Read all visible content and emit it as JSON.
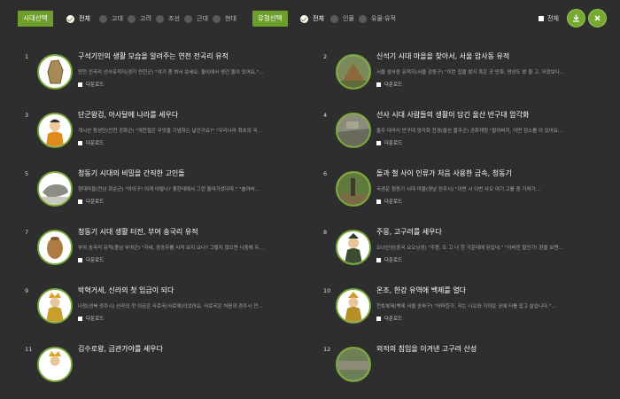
{
  "filters": {
    "era_chip": "시대선택",
    "eras": [
      {
        "label": "전체",
        "selected": true
      },
      {
        "label": "고대",
        "selected": false
      },
      {
        "label": "고려",
        "selected": false
      },
      {
        "label": "조선",
        "selected": false
      },
      {
        "label": "근대",
        "selected": false
      },
      {
        "label": "현대",
        "selected": false
      }
    ],
    "type_chip": "유형선택",
    "types": [
      {
        "label": "전체",
        "selected": true
      },
      {
        "label": "인물",
        "selected": false
      },
      {
        "label": "유물·유적",
        "selected": false
      }
    ],
    "select_all_label": "전체"
  },
  "buttons": {
    "download_icon": "download-icon",
    "close_icon": "close-icon"
  },
  "download_label": "다운로드",
  "items": [
    {
      "num": "1",
      "title": "구석기인의 생활 모습을 알려주는 연천 전곡리 유적",
      "desc": "연천 전곡리 선사유적지(경기 연천군) \"여기 좀 봐서 보세요. 돌이에서 생긴 돌이 있어요.\"…"
    },
    {
      "num": "2",
      "title": "신석기 시대 마을을 찾아서, 서울 암사동 유적",
      "desc": "서울 암사동 유적지(서울 강동구) \"이런 집을 봤지 혹은 곳 만화, 영상도 봤 줄 고, 무었보다…"
    },
    {
      "num": "3",
      "title": "단군왕검, 아사달에 나라를 세우다",
      "desc": "개시산 참성단(인천 강화군) \"개천절은 무엇을 기념하는 날인가요?\" \"우리나라 최초의 국…"
    },
    {
      "num": "4",
      "title": "선사 시대 사람들의 생활이 담긴 울산 반구대 암각화",
      "desc": "울주 대곡리 반구대 암각화 전경(울산 울주군) 공화재청 \"할아버지, 어떤 점소를 이 있어요…"
    },
    {
      "num": "5",
      "title": "청동기 시대의 비밀을 간직한 고인돌",
      "desc": "청대마을(전남 화순군) \"아이구! 이게 어떻나? 좋한데에서 그런 돌마가셨다며.\" \"솔아바…"
    },
    {
      "num": "6",
      "title": "돌과 철 사이 인류가 처음 사용한 금속, 청동기",
      "desc": "국경운 청동기 시대 마을(경남 진주시) \"이번 시 이번 사오 여기 고를 좀 가져가…"
    },
    {
      "num": "7",
      "title": "청동기 시대 생활 터전, 부여 송국리 유적",
      "desc": "부여 송국리 유적(충남 부여군) \"자네, 장승무를 서져 보지 요나? 그렇지 않으면 나중에 두…"
    },
    {
      "num": "8",
      "title": "주몽, 고구려를 세우다",
      "desc": "오녀산성(중국 요오닝성) \"주몽, 도 고 나 한 가운데에 된답네.\" \"아버린 할인가! 환을 보면…"
    },
    {
      "num": "9",
      "title": "박혁거세, 신라의 첫 임금이 되다",
      "desc": "나정(경북 경주시) 신라의 첫 이금은 사로국(사로에)이었어요. 사로국은 처음의 경주시 전…"
    },
    {
      "num": "10",
      "title": "온조, 한강 유역에 백제를 열다",
      "desc": "천호복제(백제 서울 송파구) \"어떠한가, 저는 나오와 가까운 곳에 터를 잡고 살습니다.\"…"
    },
    {
      "num": "11",
      "title": "김수로왕, 금관가야를 세우다",
      "desc": ""
    },
    {
      "num": "12",
      "title": "외적의 침입을 이겨낸 고구려 산성",
      "desc": ""
    }
  ]
}
